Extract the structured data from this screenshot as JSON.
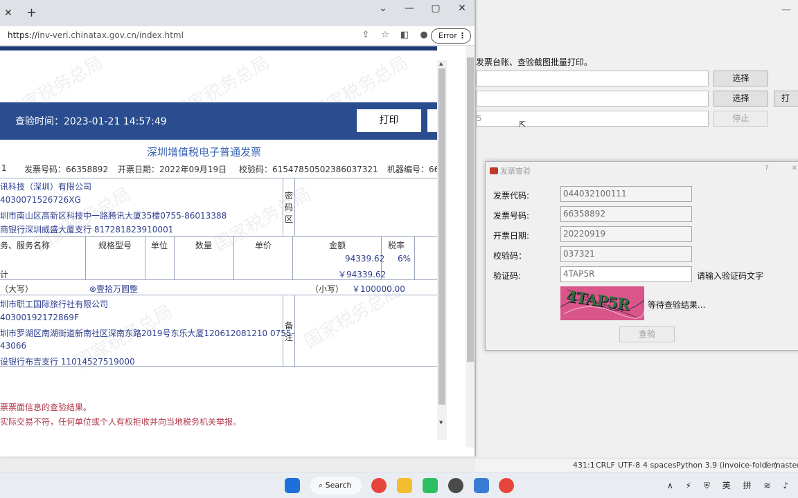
{
  "browser": {
    "url_scheme": "https://",
    "url_rest": "inv-veri.chinatax.gov.cn/index.html",
    "error_label": "Error",
    "tab_close": "✕",
    "new_tab": "+",
    "win_controls": [
      "⌄",
      "—",
      "▢",
      "✕"
    ]
  },
  "watermark_text": "国家税务总局",
  "verify": {
    "time_label": "查验时间：2023-01-21 14:57:49",
    "print_label": "打印"
  },
  "invoice": {
    "title": "深圳增值税电子普通发票",
    "meta": {
      "code_tail": "1",
      "number": "发票号码：66358892",
      "date": "开票日期：2022年09月19日",
      "check_code": "校验码：61547850502386037321",
      "machine": "机器编号：66"
    },
    "buyer": {
      "name": "讯科技（深圳）有限公司",
      "tax_id": "4030071526726XG",
      "address": "圳市南山区高新区科技中一路腾讯大厦35楼0755-86013388",
      "bank": "商银行深圳威盛大厦支行 817281823910001"
    },
    "password_area": [
      "密",
      "码",
      "区"
    ],
    "headers": {
      "item": "务、服务名称",
      "spec": "规格型号",
      "unit": "单位",
      "qty": "数量",
      "price": "单价",
      "amount": "金额",
      "rate": "税率"
    },
    "row_amount": "94339.62",
    "row_rate": "6%",
    "total_label": "计",
    "total_amount": "￥94339.62",
    "capital_label": "（大写）",
    "capital_value": "⊗壹拾万圆整",
    "small_label": "（小写）",
    "small_value": "￥100000.00",
    "seller": {
      "name": "圳市职工国际旅行社有限公司",
      "tax_id": "4030019217286​9F",
      "address": "圳市罗湖区南湖街道新南社区深南东路2019号东乐大厦120612081210 0755-",
      "address2": "43066",
      "bank": "设银行布吉支行 11014527519000"
    },
    "remark_area": [
      "备",
      "注"
    ],
    "notes": [
      "票票面信息的查验结果。",
      "实际交易不符，任何单位或个人有权拒收并向当地税务机关举报。"
    ]
  },
  "bg_app": {
    "tip": "发票台账、查验截图批量打印。",
    "row1_btn": "选择",
    "row2_btn": "选择",
    "row2_btn3": "打",
    "row3_value": "5",
    "row3_btn": "停止"
  },
  "dialog": {
    "title": "发票查验",
    "help": "?",
    "close": "✕",
    "fields": [
      {
        "label": "发票代码:",
        "value": "044032100111"
      },
      {
        "label": "发票号码:",
        "value": "66358892"
      },
      {
        "label": "开票日期:",
        "value": "20220919"
      },
      {
        "label": "校验码：",
        "value": "037321"
      },
      {
        "label": "验证码:",
        "value": "4TAP5R"
      }
    ],
    "hint": "请输入验证码文字",
    "captcha_text": "4TAP5R",
    "status": "等待查验结果...",
    "submit": "查验"
  },
  "statusbar": {
    "pos": "431:1",
    "eol": "CRLF",
    "enc": "UTF-8",
    "indent": "4 spaces",
    "lang": "Python 3.9 (invoice-folder)",
    "branch": "master"
  },
  "taskbar": {
    "search": "Search",
    "ime1": "英",
    "ime2": "拼"
  }
}
